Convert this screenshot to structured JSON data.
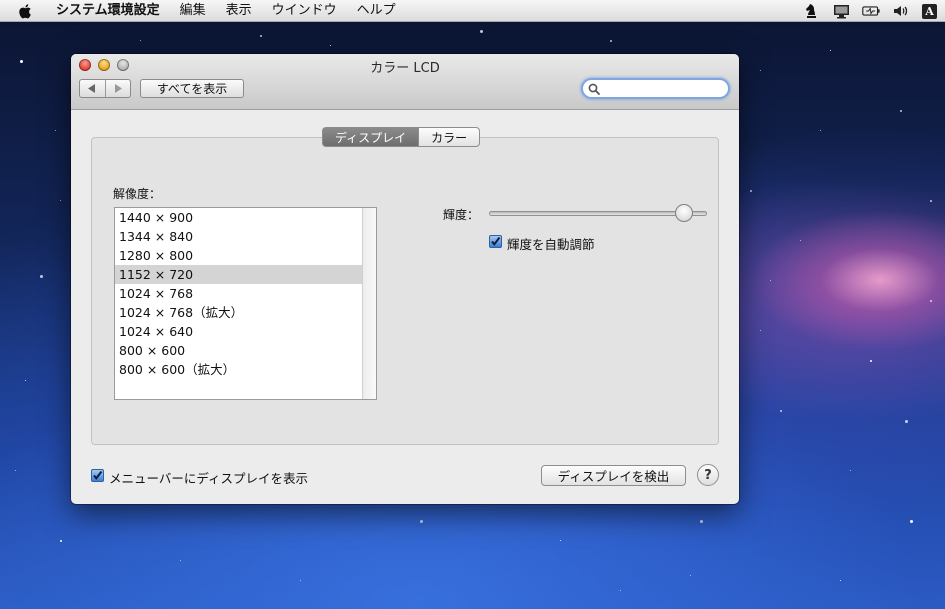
{
  "menubar": {
    "apple_icon": "apple-icon",
    "app_name": "システム環境設定",
    "items": [
      "編集",
      "表示",
      "ウインドウ",
      "ヘルプ"
    ],
    "status_icons": [
      "chess-knight-icon",
      "display-icon",
      "battery-icon",
      "volume-icon"
    ],
    "input_indicator": "A"
  },
  "window": {
    "title": "カラー LCD",
    "toolbar": {
      "back_icon": "back-arrow-icon",
      "forward_icon": "forward-arrow-icon",
      "show_all_label": "すべてを表示",
      "search_value": "",
      "search_icon": "search-icon"
    },
    "tabs": [
      {
        "label": "ディスプレイ",
        "active": true
      },
      {
        "label": "カラー",
        "active": false
      }
    ],
    "display_tab": {
      "resolution_label": "解像度：",
      "resolutions": [
        "1440 × 900",
        "1344 × 840",
        "1280 × 800",
        "1152 × 720",
        "1024 × 768",
        "1024 × 768（拡大）",
        "1024 × 640",
        "800 × 600",
        "800 × 600（拡大）"
      ],
      "selected_index": 3,
      "brightness_label": "輝度：",
      "brightness_value": 0.93,
      "auto_brightness_label": "輝度を自動調節",
      "auto_brightness_checked": true
    },
    "footer": {
      "show_in_menubar_label": "メニューバーにディスプレイを表示",
      "show_in_menubar_checked": true,
      "detect_button_label": "ディスプレイを検出",
      "help_label": "?"
    }
  },
  "colors": {
    "selection_gray": "#d4d4d4",
    "checkbox_blue": "#3d7fd3",
    "focus_ring": "#7fa6dd"
  }
}
